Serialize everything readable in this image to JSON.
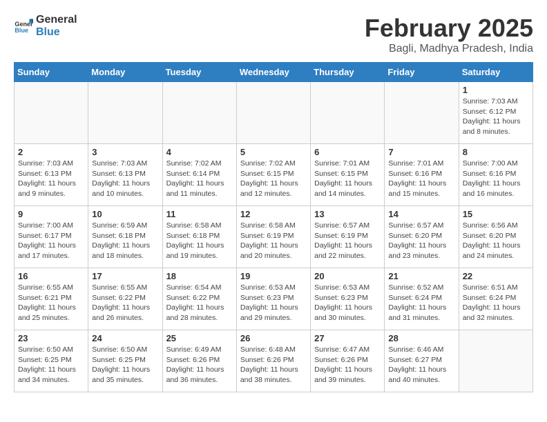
{
  "header": {
    "logo_general": "General",
    "logo_blue": "Blue",
    "month_title": "February 2025",
    "location": "Bagli, Madhya Pradesh, India"
  },
  "weekdays": [
    "Sunday",
    "Monday",
    "Tuesday",
    "Wednesday",
    "Thursday",
    "Friday",
    "Saturday"
  ],
  "weeks": [
    [
      {
        "day": "",
        "info": ""
      },
      {
        "day": "",
        "info": ""
      },
      {
        "day": "",
        "info": ""
      },
      {
        "day": "",
        "info": ""
      },
      {
        "day": "",
        "info": ""
      },
      {
        "day": "",
        "info": ""
      },
      {
        "day": "1",
        "info": "Sunrise: 7:03 AM\nSunset: 6:12 PM\nDaylight: 11 hours and 8 minutes."
      }
    ],
    [
      {
        "day": "2",
        "info": "Sunrise: 7:03 AM\nSunset: 6:13 PM\nDaylight: 11 hours and 9 minutes."
      },
      {
        "day": "3",
        "info": "Sunrise: 7:03 AM\nSunset: 6:13 PM\nDaylight: 11 hours and 10 minutes."
      },
      {
        "day": "4",
        "info": "Sunrise: 7:02 AM\nSunset: 6:14 PM\nDaylight: 11 hours and 11 minutes."
      },
      {
        "day": "5",
        "info": "Sunrise: 7:02 AM\nSunset: 6:15 PM\nDaylight: 11 hours and 12 minutes."
      },
      {
        "day": "6",
        "info": "Sunrise: 7:01 AM\nSunset: 6:15 PM\nDaylight: 11 hours and 14 minutes."
      },
      {
        "day": "7",
        "info": "Sunrise: 7:01 AM\nSunset: 6:16 PM\nDaylight: 11 hours and 15 minutes."
      },
      {
        "day": "8",
        "info": "Sunrise: 7:00 AM\nSunset: 6:16 PM\nDaylight: 11 hours and 16 minutes."
      }
    ],
    [
      {
        "day": "9",
        "info": "Sunrise: 7:00 AM\nSunset: 6:17 PM\nDaylight: 11 hours and 17 minutes."
      },
      {
        "day": "10",
        "info": "Sunrise: 6:59 AM\nSunset: 6:18 PM\nDaylight: 11 hours and 18 minutes."
      },
      {
        "day": "11",
        "info": "Sunrise: 6:58 AM\nSunset: 6:18 PM\nDaylight: 11 hours and 19 minutes."
      },
      {
        "day": "12",
        "info": "Sunrise: 6:58 AM\nSunset: 6:19 PM\nDaylight: 11 hours and 20 minutes."
      },
      {
        "day": "13",
        "info": "Sunrise: 6:57 AM\nSunset: 6:19 PM\nDaylight: 11 hours and 22 minutes."
      },
      {
        "day": "14",
        "info": "Sunrise: 6:57 AM\nSunset: 6:20 PM\nDaylight: 11 hours and 23 minutes."
      },
      {
        "day": "15",
        "info": "Sunrise: 6:56 AM\nSunset: 6:20 PM\nDaylight: 11 hours and 24 minutes."
      }
    ],
    [
      {
        "day": "16",
        "info": "Sunrise: 6:55 AM\nSunset: 6:21 PM\nDaylight: 11 hours and 25 minutes."
      },
      {
        "day": "17",
        "info": "Sunrise: 6:55 AM\nSunset: 6:22 PM\nDaylight: 11 hours and 26 minutes."
      },
      {
        "day": "18",
        "info": "Sunrise: 6:54 AM\nSunset: 6:22 PM\nDaylight: 11 hours and 28 minutes."
      },
      {
        "day": "19",
        "info": "Sunrise: 6:53 AM\nSunset: 6:23 PM\nDaylight: 11 hours and 29 minutes."
      },
      {
        "day": "20",
        "info": "Sunrise: 6:53 AM\nSunset: 6:23 PM\nDaylight: 11 hours and 30 minutes."
      },
      {
        "day": "21",
        "info": "Sunrise: 6:52 AM\nSunset: 6:24 PM\nDaylight: 11 hours and 31 minutes."
      },
      {
        "day": "22",
        "info": "Sunrise: 6:51 AM\nSunset: 6:24 PM\nDaylight: 11 hours and 32 minutes."
      }
    ],
    [
      {
        "day": "23",
        "info": "Sunrise: 6:50 AM\nSunset: 6:25 PM\nDaylight: 11 hours and 34 minutes."
      },
      {
        "day": "24",
        "info": "Sunrise: 6:50 AM\nSunset: 6:25 PM\nDaylight: 11 hours and 35 minutes."
      },
      {
        "day": "25",
        "info": "Sunrise: 6:49 AM\nSunset: 6:26 PM\nDaylight: 11 hours and 36 minutes."
      },
      {
        "day": "26",
        "info": "Sunrise: 6:48 AM\nSunset: 6:26 PM\nDaylight: 11 hours and 38 minutes."
      },
      {
        "day": "27",
        "info": "Sunrise: 6:47 AM\nSunset: 6:26 PM\nDaylight: 11 hours and 39 minutes."
      },
      {
        "day": "28",
        "info": "Sunrise: 6:46 AM\nSunset: 6:27 PM\nDaylight: 11 hours and 40 minutes."
      },
      {
        "day": "",
        "info": ""
      }
    ]
  ]
}
